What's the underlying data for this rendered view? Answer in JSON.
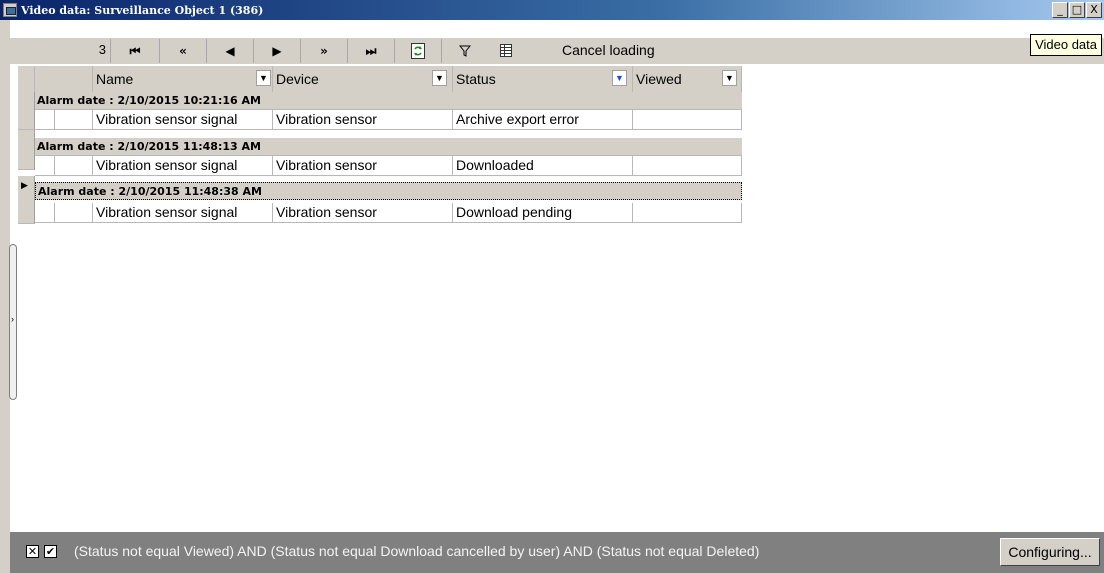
{
  "window": {
    "title": "Video data: Surveillance  Object 1 (386)",
    "buttons": [
      "_",
      "□",
      "X"
    ]
  },
  "toolbar": {
    "record_count": "3",
    "first_label": "⏮",
    "prev_page_label": "«",
    "prev_label": "◀",
    "next_label": "▶",
    "next_page_label": "»",
    "last_label": "⏭",
    "refresh_icon": "refresh-icon",
    "filter_icon": "filter-icon",
    "columns_icon": "columns-icon",
    "cancel_loading": "Cancel loading"
  },
  "tooltip": "Video data",
  "grid": {
    "columns": [
      {
        "label": "Name",
        "dropdown": "▼"
      },
      {
        "label": "Device",
        "dropdown": "▼"
      },
      {
        "label": "Status",
        "dropdown": "▼"
      },
      {
        "label": "Viewed",
        "dropdown": "▼"
      }
    ],
    "groups": [
      {
        "header": "Alarm date : 2/10/2015 10:21:16 AM",
        "row": {
          "name": "Vibration sensor signal",
          "device": "Vibration sensor",
          "status": "Archive export error",
          "viewed": ""
        }
      },
      {
        "header": "Alarm date : 2/10/2015 11:48:13 AM",
        "row": {
          "name": "Vibration sensor signal",
          "device": "Vibration sensor",
          "status": "Downloaded",
          "viewed": ""
        }
      },
      {
        "header": "Alarm date : 2/10/2015 11:48:38 AM",
        "row": {
          "name": "Vibration sensor signal",
          "device": "Vibration sensor",
          "status": "Download pending",
          "viewed": ""
        }
      }
    ],
    "current_marker": "▶"
  },
  "splitter": {
    "arrow": "›"
  },
  "filter": {
    "clear_label": "✕",
    "enabled_label": "✔",
    "expression": "(Status not equal Viewed) AND (Status not equal Download cancelled by user) AND (Status not equal Deleted)",
    "configure_label": "Configuring..."
  }
}
